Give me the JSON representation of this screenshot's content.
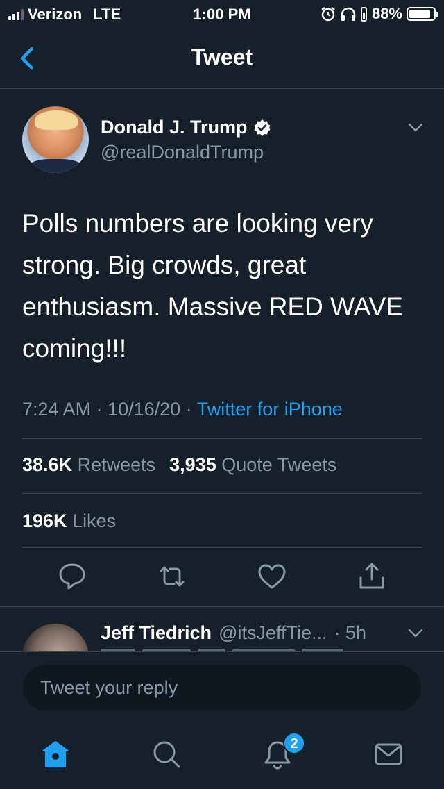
{
  "status_bar": {
    "carrier": "Verizon",
    "network": "LTE",
    "time": "1:00 PM",
    "battery_percent": "88%",
    "battery_level": 0.88,
    "icons": [
      "signal-icon",
      "alarm-icon",
      "headphones-icon",
      "battery-icon"
    ]
  },
  "header": {
    "title": "Tweet",
    "back_icon": "chevron-left-icon"
  },
  "tweet": {
    "author_name": "Donald J. Trump",
    "author_handle": "@realDonaldTrump",
    "verified": true,
    "text": "Polls numbers are looking very strong. Big crowds, great enthusiasm. Massive RED WAVE coming!!!",
    "time": "7:24 AM",
    "date": "10/16/20",
    "separator": "·",
    "source": "Twitter for iPhone",
    "retweets_count": "38.6K",
    "retweets_label": "Retweets",
    "quotes_count": "3,935",
    "quotes_label": "Quote Tweets",
    "likes_count": "196K",
    "likes_label": "Likes"
  },
  "actions": [
    "reply-icon",
    "retweet-icon",
    "like-icon",
    "share-icon"
  ],
  "reply_preview": {
    "name": "Jeff Tiedrich",
    "handle": "@itsJeffTie...",
    "time": "· 5h"
  },
  "compose": {
    "placeholder": "Tweet your reply"
  },
  "tab_bar": {
    "tabs": [
      "home-icon",
      "search-icon",
      "notifications-icon",
      "messages-icon"
    ],
    "notification_badge": "2"
  },
  "colors": {
    "background": "#15202b",
    "accent": "#1da1f2",
    "muted": "#8899a6",
    "divider": "#38444d"
  }
}
